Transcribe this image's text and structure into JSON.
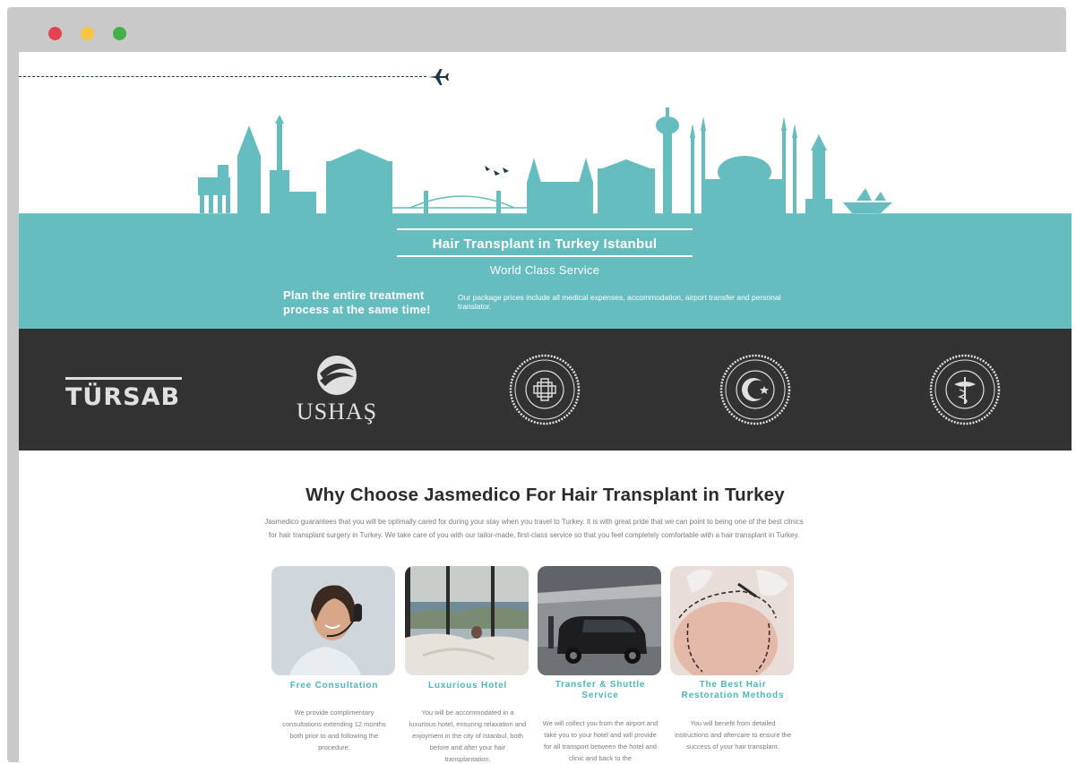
{
  "hero": {
    "title": "Hair Transplant in Turkey Istanbul",
    "subtitle": "World Class Service",
    "plan_text": "Plan the entire treatment process at the same time!",
    "package_text": "Our package prices include all medical expenses, accommodation, airport transfer and personal translator."
  },
  "partners": {
    "tursab": "TÜRSAB",
    "ushas": "USHAŞ"
  },
  "why": {
    "title": "Why Choose Jasmedico For Hair Transplant in Turkey",
    "description": "Jasmedico guarantees that you will be optimally cared for during your stay when you travel to Turkey. It is with great pride that we can point to being one of the best clinics for hair transplant surgery in Turkey. We take care of you with our tailor-made, first-class service so that you feel completely comfortable with a hair transplant in Turkey."
  },
  "cards": [
    {
      "title": "Free Consultation",
      "text": "We provide complimentary consultations extending 12 months both prior to and following the procedure."
    },
    {
      "title": "Luxurious Hotel",
      "text": "You will be accommodated in a luxurious hotel, ensuring relaxation and enjoyment in the city of Istanbul, both before and after your hair transplantation."
    },
    {
      "title": "Transfer & Shuttle Service",
      "text": "We will collect you from the airport and take you to your hotel and will provide for all transport between the hotel and clinic and back to the"
    },
    {
      "title": "The Best Hair Restoration Methods",
      "text": "You will benefit from detailed instructions and aftercare to ensure the success of your hair transplant."
    }
  ],
  "colors": {
    "teal": "#66bdc0",
    "teal_title": "#4bb8bc",
    "dark": "#323232",
    "navy": "#1e3550"
  },
  "icons": [
    "airplane-icon",
    "window-close-dot",
    "window-minimize-dot",
    "window-maximize-dot"
  ]
}
